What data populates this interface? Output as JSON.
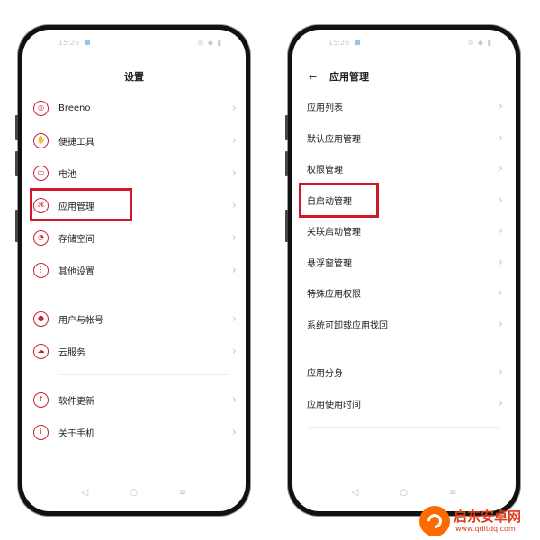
{
  "left_phone": {
    "status_time": "15:26",
    "status_icons": "⊘ ◆ ▮",
    "title": "设置",
    "items": [
      {
        "label": "Breeno",
        "icon": "breeno-icon",
        "glyph": "◎"
      },
      {
        "label": "便捷工具",
        "icon": "hand-icon",
        "glyph": "✋"
      },
      {
        "label": "电池",
        "icon": "battery-icon",
        "glyph": "▭"
      },
      {
        "label": "应用管理",
        "icon": "apps-icon",
        "glyph": "⌘"
      },
      {
        "label": "存储空间",
        "icon": "storage-icon",
        "glyph": "◔"
      },
      {
        "label": "其他设置",
        "icon": "more-settings-icon",
        "glyph": "⋮"
      },
      {
        "label": "用户与帐号",
        "icon": "user-icon",
        "glyph": "●"
      },
      {
        "label": "云服务",
        "icon": "cloud-icon",
        "glyph": "☁"
      },
      {
        "label": "软件更新",
        "icon": "update-icon",
        "glyph": "↑"
      },
      {
        "label": "关于手机",
        "icon": "info-icon",
        "glyph": "i"
      }
    ],
    "highlighted": "应用管理"
  },
  "right_phone": {
    "status_time": "15:26",
    "status_icons": "⊘ ◆ ▮",
    "back_glyph": "←",
    "title": "应用管理",
    "items": [
      {
        "label": "应用列表"
      },
      {
        "label": "默认应用管理"
      },
      {
        "label": "权限管理"
      },
      {
        "label": "自启动管理"
      },
      {
        "label": "关联启动管理"
      },
      {
        "label": "悬浮窗管理"
      },
      {
        "label": "特殊应用权限"
      },
      {
        "label": "系统可卸载应用找回"
      },
      {
        "label": "应用分身"
      },
      {
        "label": "应用使用时间"
      }
    ],
    "highlighted": "自启动管理"
  },
  "chevron": "›",
  "nav": {
    "back": "◁",
    "home": "○",
    "menu": "≡"
  },
  "colors": {
    "accent": "#c8223a",
    "highlight": "#d0182b",
    "watermark": "#e03a16"
  },
  "watermark": {
    "title": "启东安卓网",
    "url": "www.qdltdq.com"
  }
}
